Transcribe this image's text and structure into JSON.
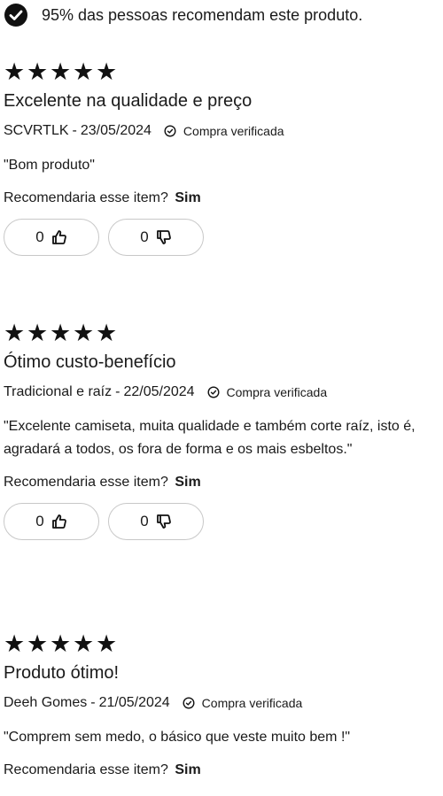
{
  "summary": {
    "text": "95% das pessoas recomendam este produto."
  },
  "reviews": [
    {
      "stars": [
        "★",
        "★",
        "★",
        "★",
        "★"
      ],
      "title": "Excelente na qualidade e preço",
      "author": "SCVRTLK",
      "date": "23/05/2024",
      "separator": "-",
      "verified_label": "Compra verificada",
      "comment": "\"Bom produto\"",
      "recommend_label": "Recomendaria esse item?",
      "recommend_answer": "Sim",
      "upvotes": "0",
      "downvotes": "0"
    },
    {
      "stars": [
        "★",
        "★",
        "★",
        "★",
        "★"
      ],
      "title": "Ótimo custo-benefício",
      "author": "Tradicional e raíz",
      "date": "22/05/2024",
      "separator": "-",
      "verified_label": "Compra verificada",
      "comment": "\"Excelente camiseta, muita qualidade e também corte raíz, isto é, agradará a todos, os fora de forma e os mais esbeltos.\"",
      "recommend_label": "Recomendaria esse item?",
      "recommend_answer": "Sim",
      "upvotes": "0",
      "downvotes": "0"
    },
    {
      "stars": [
        "★",
        "★",
        "★",
        "★",
        "★"
      ],
      "title": "Produto ótimo!",
      "author": "Deeh Gomes",
      "date": "21/05/2024",
      "separator": "-",
      "verified_label": "Compra verificada",
      "comment": "\"Comprem sem medo, o básico que veste muito bem !\"",
      "recommend_label": "Recomendaria esse item?",
      "recommend_answer": "Sim"
    }
  ]
}
